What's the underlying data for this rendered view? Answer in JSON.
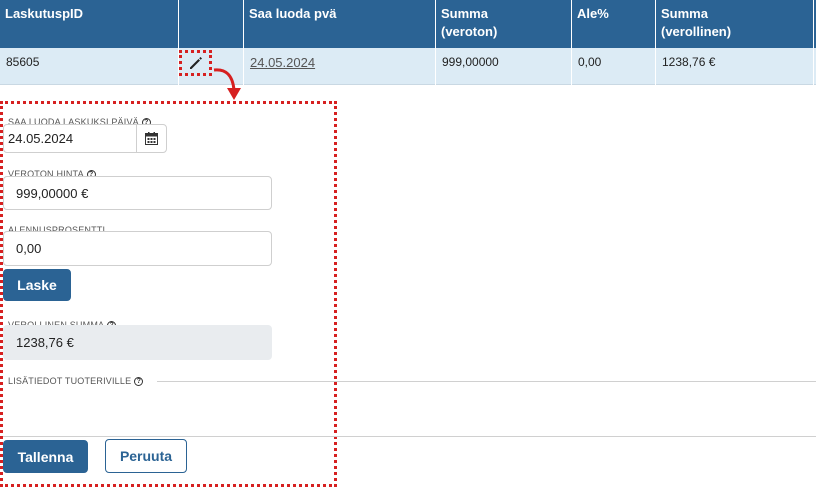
{
  "table": {
    "headers": [
      [
        "LaskutuspID",
        ""
      ],
      [
        "",
        ""
      ],
      [
        "Saa luoda pvä",
        ""
      ],
      [
        "Summa",
        "(veroton)"
      ],
      [
        "Ale%",
        ""
      ],
      [
        "Summa",
        "(verollinen)"
      ]
    ],
    "row": {
      "id": "85605",
      "date": "24.05.2024",
      "sum_net": "999,00000",
      "discount": "0,00",
      "sum_gross": "1238,76 €"
    }
  },
  "form": {
    "date_label": "SAA LUODA LASKUKSI PÄIVÄ",
    "date_value": "24.05.2024",
    "net_label": "VEROTON HINTA",
    "net_value": "999,00000 €",
    "discount_label": "ALENNUSPROSENTTI",
    "discount_value": "0,00",
    "calc_button": "Laske",
    "gross_label": "VEROLLINEN SUMMA",
    "gross_value": "1238,76 €",
    "extra_label": "LISÄTIEDOT TUOTERIVILLE",
    "save_button": "Tallenna",
    "cancel_button": "Peruuta"
  },
  "colors": {
    "header_bg": "#2b6394",
    "row_bg": "#dcebf5",
    "highlight": "#d62020"
  }
}
